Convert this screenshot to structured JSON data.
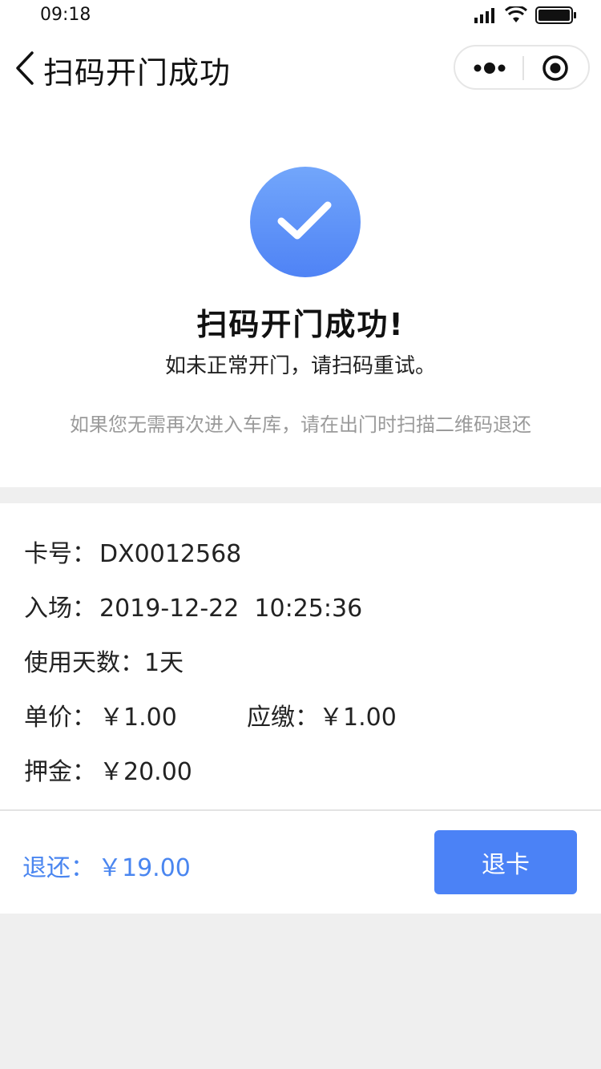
{
  "status_bar": {
    "time": "09:18"
  },
  "nav": {
    "title": "扫码开门成功"
  },
  "success": {
    "title": "扫码开门成功!",
    "subtitle": "如未正常开门，请扫码重试。",
    "hint": "如果您无需再次进入车库，请在出门时扫描二维码退还"
  },
  "info": {
    "card_label": "卡号：",
    "card_value": "DX0012568",
    "enter_label": "入场：",
    "enter_value": "2019-12-22  10:25:36",
    "days_label": "使用天数：",
    "days_value": "1天",
    "price_label": "单价：",
    "price_value": "￥1.00",
    "due_label": "应缴：",
    "due_value": "￥1.00",
    "deposit_label": "押金：",
    "deposit_value": "￥20.00"
  },
  "action": {
    "refund_label": "退还：",
    "refund_value": "￥19.00",
    "button_label": "退卡"
  },
  "colors": {
    "accent": "#4b82f6",
    "refund_text": "#4a86f0",
    "hint": "#9a9a9a"
  },
  "icons": [
    "signal-icon",
    "wifi-icon",
    "battery-icon",
    "back-arrow-icon",
    "more-icon",
    "close-target-icon",
    "check-icon"
  ]
}
